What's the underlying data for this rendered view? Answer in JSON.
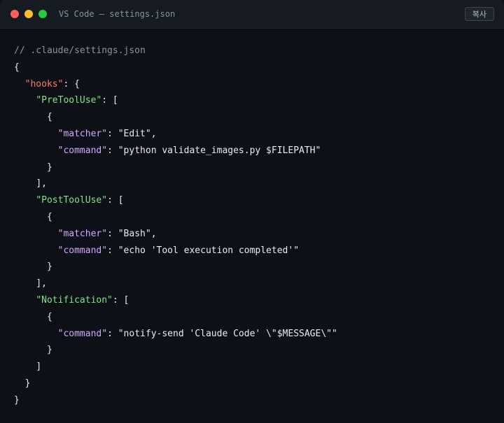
{
  "window": {
    "title": "VS Code — settings.json",
    "copy_label": "복사"
  },
  "code": {
    "comment": "// .claude/settings.json",
    "open_brace": "{",
    "close_brace": "}",
    "hooks_key": "\"hooks\"",
    "hooks": [
      {
        "event_key": "\"PreToolUse\"",
        "matcher_key": "\"matcher\"",
        "matcher_value": "\"Edit\"",
        "command_key": "\"command\"",
        "command_value": "\"python validate_images.py $FILEPATH\""
      },
      {
        "event_key": "\"PostToolUse\"",
        "matcher_key": "\"matcher\"",
        "matcher_value": "\"Bash\"",
        "command_key": "\"command\"",
        "command_value": "\"echo 'Tool execution completed'\""
      },
      {
        "event_key": "\"Notification\"",
        "command_key": "\"command\"",
        "command_value": "\"notify-send 'Claude Code' \\\"$MESSAGE\\\"\""
      }
    ]
  },
  "colors": {
    "background": "#0d1117",
    "titlebar": "#161b22",
    "key_top": "#ff7b72",
    "key_event": "#7ee787",
    "key_field": "#d2a8ff",
    "comment": "#8b949e"
  },
  "icons": [
    "close-dot-icon",
    "minimize-dot-icon",
    "maximize-dot-icon"
  ]
}
